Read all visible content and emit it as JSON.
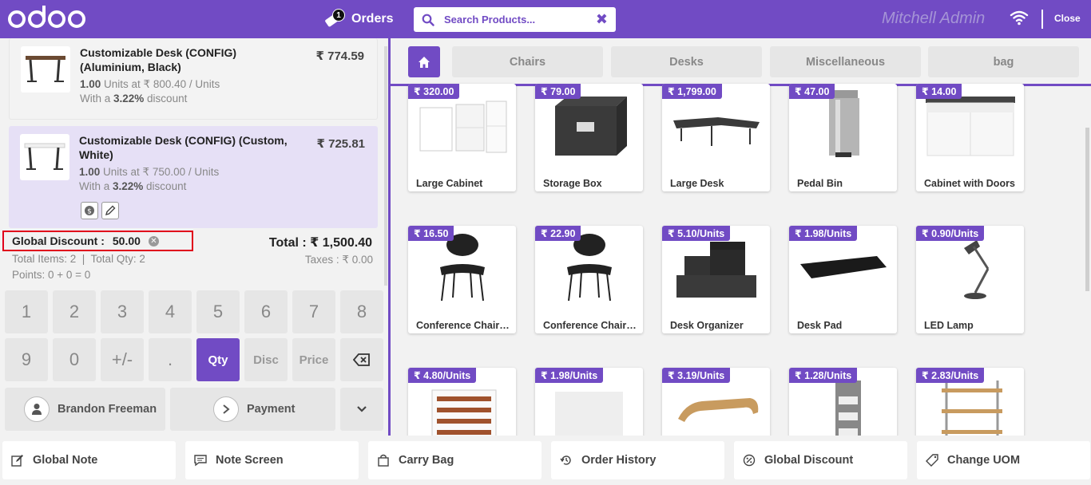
{
  "header": {
    "logo_text": "odoo",
    "orders_label": "Orders",
    "orders_badge": "1",
    "search_placeholder": "Search Products...",
    "user": "Mitchell Admin",
    "close_label": "Close"
  },
  "order_lines": [
    {
      "name": "Customizable Desk (CONFIG) (Aluminium, Black)",
      "price": "₹ 774.59",
      "qty": "1.00",
      "qty_rest": " Units at ₹ 800.40 / Units",
      "disc_prefix": "With a ",
      "disc_value": "3.22%",
      "disc_suffix": " discount"
    },
    {
      "name": "Customizable Desk (CONFIG) (Custom, White)",
      "price": "₹ 725.81",
      "qty": "1.00",
      "qty_rest": " Units at ₹ 750.00 / Units",
      "disc_prefix": "With a ",
      "disc_value": "3.22%",
      "disc_suffix": " discount"
    }
  ],
  "summary": {
    "global_discount_label": "Global Discount :",
    "global_discount_value": "50.00",
    "total": "Total : ₹ 1,500.40",
    "items": "Total Items: 2  |  Total Qty: 2",
    "taxes": "Taxes : ₹ 0.00",
    "points": "Points: 0 + 0 = 0"
  },
  "numpad": {
    "row1": [
      "1",
      "2",
      "3",
      "4",
      "5",
      "6",
      "7",
      "8"
    ],
    "row2": [
      "9",
      "0",
      "+/-",
      ".",
      "Qty",
      "Disc",
      "Price"
    ],
    "customer": "Brandon Freeman",
    "payment": "Payment"
  },
  "categories": [
    "Chairs",
    "Desks",
    "Miscellaneous",
    "bag"
  ],
  "products": [
    {
      "name": "Large Cabinet",
      "price": "₹ 320.00",
      "icon": "cabinet"
    },
    {
      "name": "Storage Box",
      "price": "₹ 79.00",
      "icon": "box"
    },
    {
      "name": "Large Desk",
      "price": "₹ 1,799.00",
      "icon": "desk"
    },
    {
      "name": "Pedal Bin",
      "price": "₹ 47.00",
      "icon": "bin"
    },
    {
      "name": "Cabinet with Doors",
      "price": "₹ 14.00",
      "icon": "cabinet-doors"
    },
    {
      "name": "Conference Chair…",
      "price": "₹ 16.50",
      "icon": "chair"
    },
    {
      "name": "Conference Chair…",
      "price": "₹ 22.90",
      "icon": "chair"
    },
    {
      "name": "Desk Organizer",
      "price": "₹ 5.10/Units",
      "icon": "organizer"
    },
    {
      "name": "Desk Pad",
      "price": "₹ 1.98/Units",
      "icon": "pad"
    },
    {
      "name": "LED Lamp",
      "price": "₹ 0.90/Units",
      "icon": "lamp"
    },
    {
      "name": "",
      "price": "₹ 4.80/Units",
      "icon": "shelf"
    },
    {
      "name": "",
      "price": "₹ 1.98/Units",
      "icon": "blank"
    },
    {
      "name": "",
      "price": "₹ 3.19/Units",
      "icon": "stand"
    },
    {
      "name": "",
      "price": "₹ 1.28/Units",
      "icon": "rack"
    },
    {
      "name": "",
      "price": "₹ 2.83/Units",
      "icon": "shelving"
    }
  ],
  "bottom_actions": [
    "Global Note",
    "Note Screen",
    "Carry Bag",
    "Order History",
    "Global Discount",
    "Change UOM"
  ],
  "colors": {
    "accent": "#714bc4",
    "highlight_border": "#e0001b"
  }
}
